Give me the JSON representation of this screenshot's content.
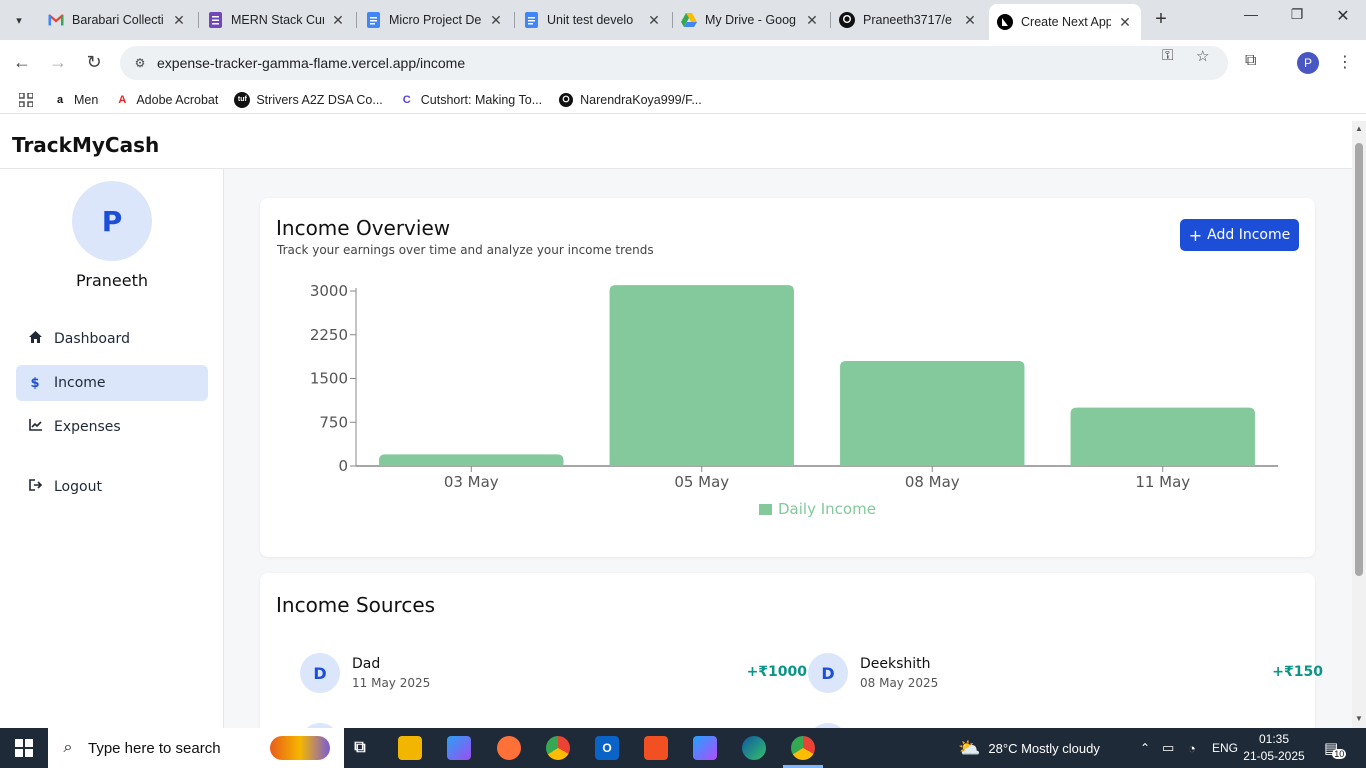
{
  "browser": {
    "tabs": [
      {
        "label": "Barabari Collecti",
        "icon": "gmail-icon",
        "color": "#ea4335"
      },
      {
        "label": "MERN Stack Cur",
        "icon": "forms-icon",
        "color": "#7248b9"
      },
      {
        "label": "Micro Project De",
        "icon": "docs-icon",
        "color": "#4285f4"
      },
      {
        "label": "Unit test develo",
        "icon": "docs-icon",
        "color": "#4285f4"
      },
      {
        "label": "My Drive - Goog",
        "icon": "drive-icon",
        "color": "#34a853"
      },
      {
        "label": "Praneeth3717/e",
        "icon": "github-icon",
        "color": "#111111"
      },
      {
        "label": "Create Next App",
        "icon": "nextjs-icon",
        "color": "#000000"
      }
    ],
    "url": "expense-tracker-gamma-flame.vercel.app/income",
    "profile_initial": "P",
    "bookmarks": [
      {
        "label": "Men",
        "icon": "amazon-icon"
      },
      {
        "label": "Adobe Acrobat",
        "icon": "acrobat-icon"
      },
      {
        "label": "Strivers A2Z DSA Co...",
        "icon": "tuf-icon"
      },
      {
        "label": "Cutshort: Making To...",
        "icon": "cutshort-icon"
      },
      {
        "label": "NarendraKoya999/F...",
        "icon": "github-icon"
      }
    ]
  },
  "app": {
    "brand": "TrackMyCash",
    "user": {
      "initial": "P",
      "name": "Praneeth"
    },
    "nav": [
      {
        "label": "Dashboard",
        "icon": "home-icon"
      },
      {
        "label": "Income",
        "icon": "dollar-icon"
      },
      {
        "label": "Expenses",
        "icon": "chart-icon"
      },
      {
        "label": "Logout",
        "icon": "logout-icon"
      }
    ],
    "overview": {
      "title": "Income Overview",
      "subtitle": "Track your earnings over time and analyze your income trends",
      "add_button": "Add Income"
    },
    "sources": {
      "title": "Income Sources",
      "items": [
        {
          "initial": "D",
          "name": "Dad",
          "date": "11 May 2025",
          "amount": "+₹1000"
        },
        {
          "initial": "D",
          "name": "Deekshith",
          "date": "08 May 2025",
          "amount": "+₹150"
        }
      ]
    }
  },
  "chart_data": {
    "type": "bar",
    "categories": [
      "03 May",
      "05 May",
      "08 May",
      "11 May"
    ],
    "series": [
      {
        "name": "Daily Income",
        "values": [
          200,
          3100,
          1800,
          1000
        ]
      }
    ],
    "yticks": [
      0,
      750,
      1500,
      2250,
      3000
    ],
    "ylim": [
      0,
      3000
    ],
    "bar_color": "#83c99b",
    "legend_position": "bottom-center"
  },
  "taskbar": {
    "search_placeholder": "Type here to search",
    "weather": "28°C  Mostly cloudy",
    "language": "ENG",
    "time": "01:35",
    "date": "21-05-2025",
    "notifications": "10"
  }
}
